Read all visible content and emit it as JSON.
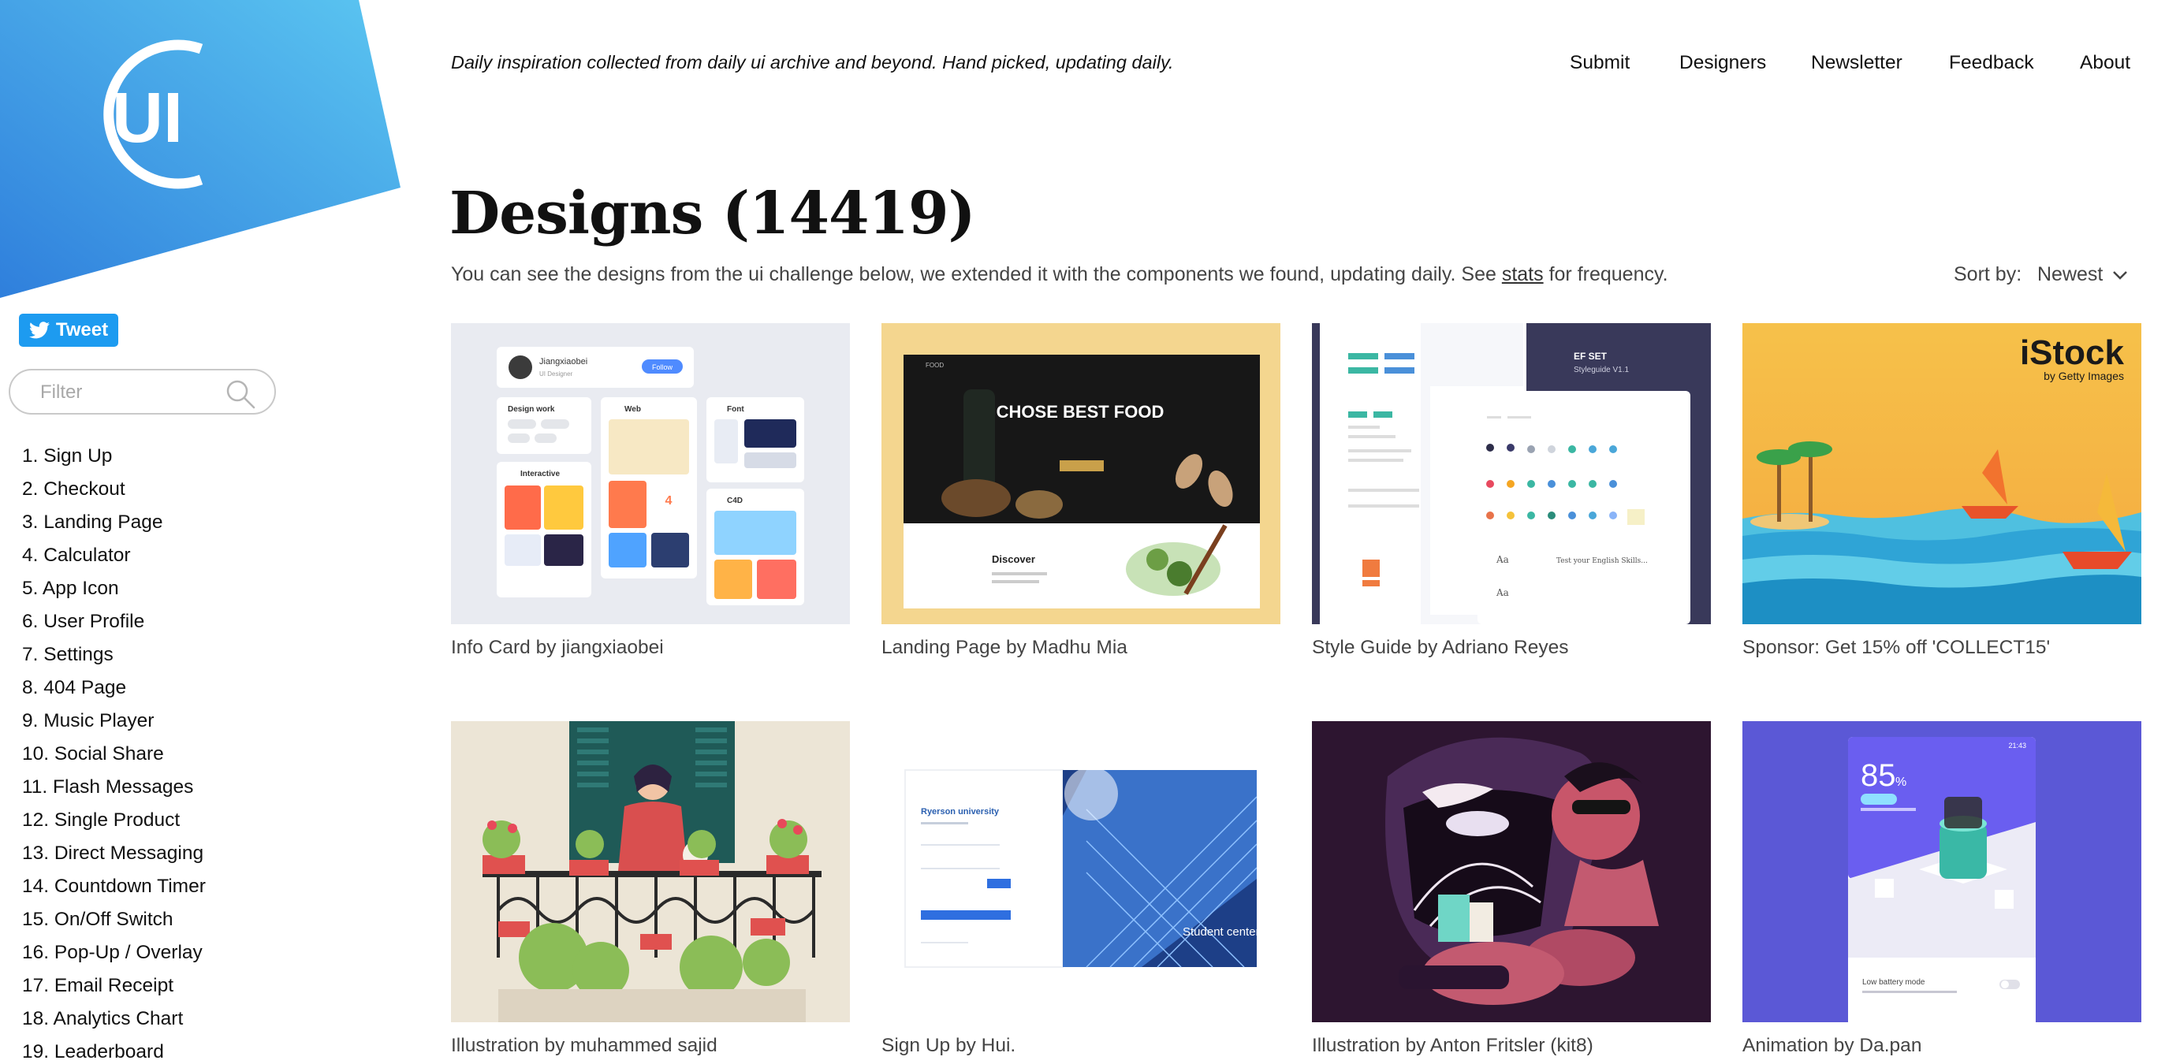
{
  "brand": {
    "logo_text": "UI",
    "logo_bg_start": "#2f7fdc",
    "logo_bg_end": "#5bc6f1"
  },
  "header": {
    "tagline": "Daily inspiration collected from daily ui archive and beyond. Hand picked, updating daily.",
    "nav": [
      "Submit",
      "Designers",
      "Newsletter",
      "Feedback",
      "About"
    ]
  },
  "sidebar": {
    "tweet_label": "Tweet",
    "filter_placeholder": "Filter",
    "challenges": [
      "1. Sign Up",
      "2. Checkout",
      "3. Landing Page",
      "4. Calculator",
      "5. App Icon",
      "6. User Profile",
      "7. Settings",
      "8. 404 Page",
      "9. Music Player",
      "10. Social Share",
      "11. Flash Messages",
      "12. Single Product",
      "13. Direct Messaging",
      "14. Countdown Timer",
      "15. On/Off Switch",
      "16. Pop-Up / Overlay",
      "17. Email Receipt",
      "18. Analytics Chart",
      "19. Leaderboard"
    ]
  },
  "main": {
    "title": "Designs (14419)",
    "subtitle_before": "You can see the designs from the ui challenge below, we extended it with the components we found, updating daily. See ",
    "stats_link": "stats",
    "subtitle_after": " for frequency.",
    "sort_label": "Sort by:",
    "sort_value": "Newest",
    "cards": [
      {
        "caption": "Info Card by jiangxiaobei",
        "thumb_text": [
          "Jiangxiaobei",
          "UI Designer",
          "Follow",
          "Design work",
          "Web",
          "Font",
          "Interactive",
          "C4D",
          "4"
        ]
      },
      {
        "caption": "Landing Page by Madhu Mia",
        "thumb_text": [
          "FOOD",
          "CHOSE BEST FOOD",
          "Discover"
        ]
      },
      {
        "caption": "Style Guide by Adriano Reyes",
        "thumb_text": [
          "EF SET",
          "Styleguide V1.1",
          "Test your English Skills..."
        ]
      },
      {
        "caption": "Sponsor: Get 15% off 'COLLECT15'",
        "thumb_text": [
          "iStock",
          "by Getty Images"
        ]
      },
      {
        "caption": "Illustration by muhammed sajid",
        "thumb_text": []
      },
      {
        "caption": "Sign Up by Hui.",
        "thumb_text": [
          "Ryerson university",
          "Student center."
        ]
      },
      {
        "caption": "Illustration by Anton Fritsler (kit8)",
        "thumb_text": []
      },
      {
        "caption": "Animation by Da.pan",
        "thumb_text": [
          "85",
          "21:43",
          "Low battery mode"
        ]
      }
    ]
  }
}
